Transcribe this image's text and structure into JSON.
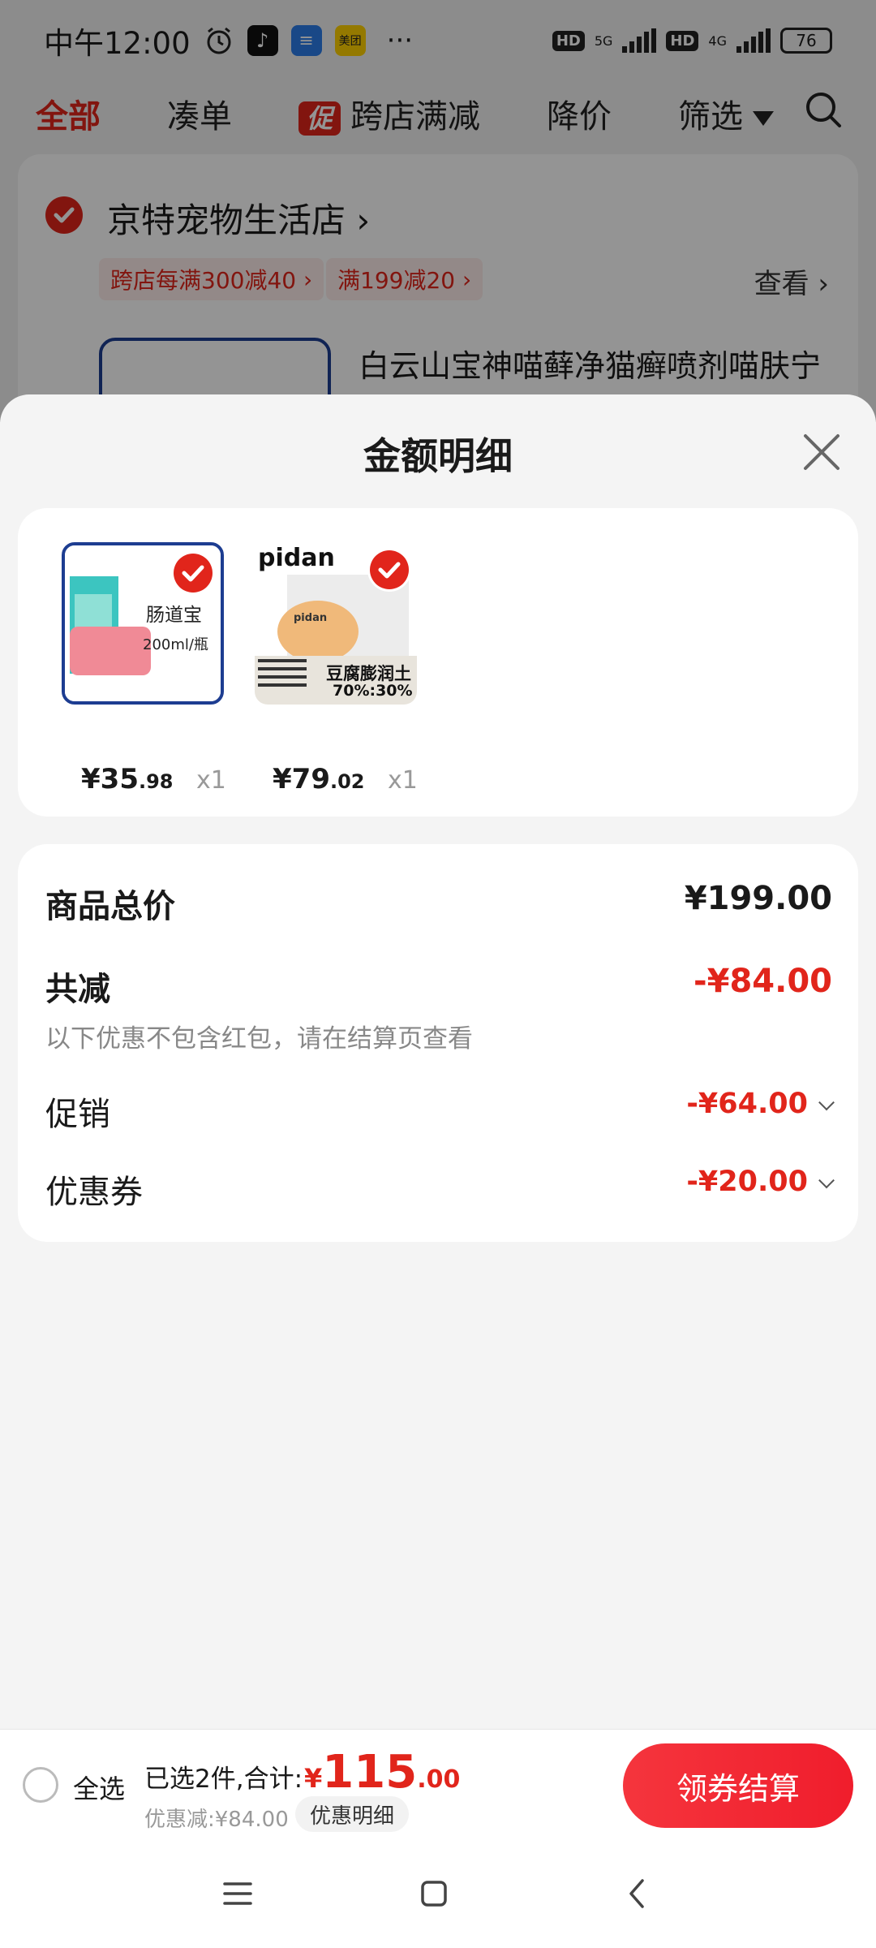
{
  "status_bar": {
    "time": "中午12:00",
    "app_icons": [
      "alarm-icon",
      "tiktok-icon",
      "layers-app-icon",
      "meituan-icon"
    ],
    "meituan_label": "美团",
    "more": "···",
    "hd1": "HD",
    "net1": "5G",
    "hd2": "HD",
    "net2": "4G",
    "battery": "76"
  },
  "top_tabs": {
    "all": "全部",
    "combine": "凑单",
    "promo_badge": "促",
    "cross_store": "跨店满减",
    "price_drop": "降价",
    "filter": "筛选"
  },
  "store": {
    "name": "京特宠物生活店",
    "tags": [
      "跨店每满300减40",
      "满199减20"
    ],
    "view": "查看",
    "product_title": "白云山宝神喵藓净猫癣喷剂喵肤宁"
  },
  "sheet": {
    "title": "金额明细",
    "items": [
      {
        "thumb_title": "肠道宝",
        "thumb_sub": "200ml/瓶",
        "price_int": "¥35",
        "price_dec": ".98",
        "qty": "x1"
      },
      {
        "brand": "pidan",
        "brand_small": "pidan",
        "thumb_title": "豆腐膨润土",
        "thumb_sub": "70%:30%",
        "price_int": "¥79",
        "price_dec": ".02",
        "qty": "x1"
      }
    ],
    "summary": {
      "total_label": "商品总价",
      "total_value": "¥199.00",
      "reduce_label": "共减",
      "reduce_value": "-¥84.00",
      "note": "以下优惠不包含红包，请在结算页查看",
      "promo_label": "促销",
      "promo_value": "-¥64.00",
      "coupon_label": "优惠券",
      "coupon_value": "-¥20.00"
    }
  },
  "bottom_bar": {
    "select_all": "全选",
    "selected_text": "已选2件,合计:",
    "total_yen": "¥",
    "total_int": "115",
    "total_dec": ".00",
    "discount_text": "优惠减:¥84.00",
    "detail_chip": "优惠明细",
    "checkout": "领券结算"
  },
  "nav_bar": {
    "buttons": [
      "menu-icon",
      "home-square-icon",
      "back-chevron-icon"
    ]
  },
  "colors": {
    "accent_red": "#e1251b",
    "overlay": "rgba(0,0,0,0.42)"
  }
}
